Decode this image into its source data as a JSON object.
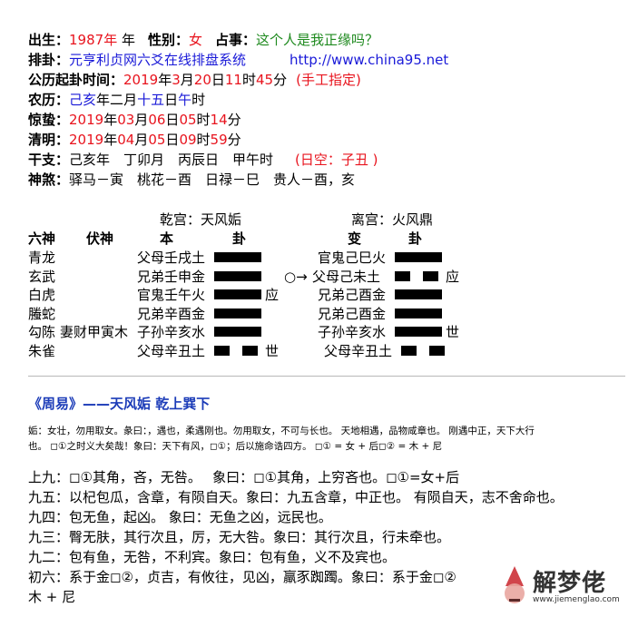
{
  "info": {
    "chusheng_label": "出生：",
    "year": "1987年",
    "year_suffix": " 年",
    "sex_label": "性别：",
    "sex": "女",
    "zhanshi_label": "占事：",
    "zhanshi": "这个人是我正缘吗？",
    "paigua_label": "排卦：",
    "system": "元亨利贞网六爻在线排盘系统",
    "url": "http://www.china95.net",
    "gongli_label": "公历起卦时间：",
    "gongli_y": "2019",
    "gongli_m": "3",
    "gongli_d": "20",
    "gongli_h": "11",
    "gongli_min": "45",
    "manual": "(手工指定)",
    "nongli_label": "农历：",
    "nongli_y": "己亥",
    "nongli_m": "二",
    "nongli_d": "十五",
    "nongli_h": "午",
    "jingzhe_label": "惊蛰：",
    "jingzhe_y": "2019",
    "jingzhe_m": "03",
    "jingzhe_d": "06",
    "jingzhe_h": "05",
    "jingzhe_min": "14",
    "qingming_label": "清明：",
    "qingming_y": "2019",
    "qingming_m": "04",
    "qingming_d": "05",
    "qingming_h": "09",
    "qingming_min": "59",
    "ganzhi_label": "干支：",
    "ganzhi": "己亥年　丁卯月　丙辰日　甲午时",
    "kong": "(日空：子丑 )",
    "shensha_label": "神煞：",
    "shensha": "驿马－寅　桃花－酉　日禄－巳　贵人－酉，亥",
    "unit_y": "年",
    "unit_m": "月",
    "unit_d": "日",
    "unit_h": "时",
    "unit_min": "分"
  },
  "table": {
    "gong_left": "乾宫：天风姤",
    "gong_right": "离宫：火风鼎",
    "h_liushen": "六神",
    "h_fushen": "伏神",
    "h_ben": "本",
    "h_gua": "卦",
    "h_bian": "变",
    "h_gua2": "卦",
    "rows": [
      {
        "shen": "青龙",
        "fu": "",
        "ben": "父母壬戌土",
        "ben_yao": "yang",
        "ben_mark": "",
        "move": "",
        "bian": "官鬼己巳火",
        "bian_yao": "yang",
        "bian_mark": ""
      },
      {
        "shen": "玄武",
        "fu": "",
        "ben": "兄弟壬申金",
        "ben_yao": "yang",
        "ben_mark": "",
        "move": "○→",
        "bian": "父母己未土",
        "bian_yao": "yin",
        "bian_mark": "应"
      },
      {
        "shen": "白虎",
        "fu": "",
        "ben": "官鬼壬午火",
        "ben_yao": "yang",
        "ben_mark": "应",
        "move": "",
        "bian": "兄弟己酉金",
        "bian_yao": "yang",
        "bian_mark": ""
      },
      {
        "shen": "螣蛇",
        "fu": "",
        "ben": "兄弟辛酉金",
        "ben_yao": "yang",
        "ben_mark": "",
        "move": "",
        "bian": "兄弟己酉金",
        "bian_yao": "yang",
        "bian_mark": ""
      },
      {
        "shen": "勾陈",
        "fu": "妻财甲寅木",
        "ben": "子孙辛亥水",
        "ben_yao": "yang",
        "ben_mark": "",
        "move": "",
        "bian": "子孙辛亥水",
        "bian_yao": "yang",
        "bian_mark": "世"
      },
      {
        "shen": "朱雀",
        "fu": "",
        "ben": "父母辛丑土",
        "ben_yao": "yin",
        "ben_mark": "世",
        "move": "",
        "bian": "父母辛丑土",
        "bian_yao": "yin",
        "bian_mark": ""
      }
    ]
  },
  "zhouyi": {
    "title": "《周易》——天风姤 乾上巽下",
    "intro_1": "姤：女壮，勿用取女。彖曰：，遇也，柔遇刚也。勿用取女，不可与长也。 天地相遇，品物咸章也。 刚遇中正，天下大行",
    "intro_2": "也。 ◻①之时义大矣哉！象曰：天下有风，◻①；后以施命诰四方。 ◻① = 女 + 后◻② = 木 + 尼",
    "lines": [
      "上九：◻①其角，吝，无咎。　 象曰：◻①其角，上穷吝也。◻①=女+后",
      "九五：以杞包瓜，含章，有陨自天。象曰：九五含章，中正也。 有陨自天，志不舍命也。",
      "九四：包无鱼，起凶。 象曰：无鱼之凶，远民也。",
      "九三：臀无肤，其行次且，厉，无大咎。象曰：其行次且，行未牵也。",
      "九二：包有鱼，无咎，不利宾。象曰：包有鱼，义不及宾也。",
      "初六：系于金◻②，贞吉，有攸往，见凶，羸豕踟躅。象曰：系于金◻②",
      "木 + 尼"
    ]
  },
  "watermark": {
    "brand": "解梦佬",
    "url": "www.jiemenglao.com"
  }
}
